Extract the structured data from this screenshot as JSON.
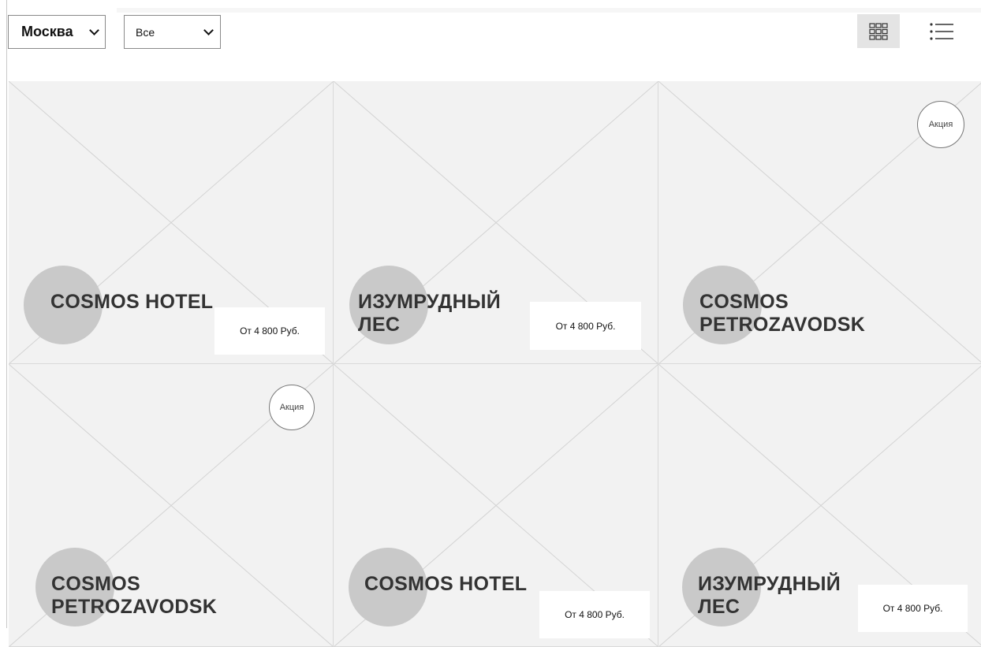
{
  "filters": {
    "city": "Москва",
    "category": "Все"
  },
  "view_toggle": {
    "grid_icon": "grid-icon",
    "list_icon": "list-icon",
    "active": "grid"
  },
  "cards": [
    {
      "name": "COSMOS HOTEL",
      "price": "От 4 800 Руб.",
      "promo": ""
    },
    {
      "name": "ИЗУМРУДНЫЙ\nЛЕС",
      "price": "От 4 800 Руб.",
      "promo": ""
    },
    {
      "name": "COSMOS\nPETROZAVODSK",
      "price": "",
      "promo": "Акция"
    },
    {
      "name": "COSMOS\nPETROZAVODSK",
      "price": "",
      "promo": "Акция"
    },
    {
      "name": "COSMOS HOTEL",
      "price": "От 4 800 Руб.",
      "promo": ""
    },
    {
      "name": "ИЗУМРУДНЫЙ\nЛЕС",
      "price": "От 4 800 Руб.",
      "promo": ""
    }
  ],
  "colors": {
    "card_background": "#f2f2f2",
    "placeholder_circle": "#c9c9c9",
    "active_view_background": "#e4e4e4"
  }
}
